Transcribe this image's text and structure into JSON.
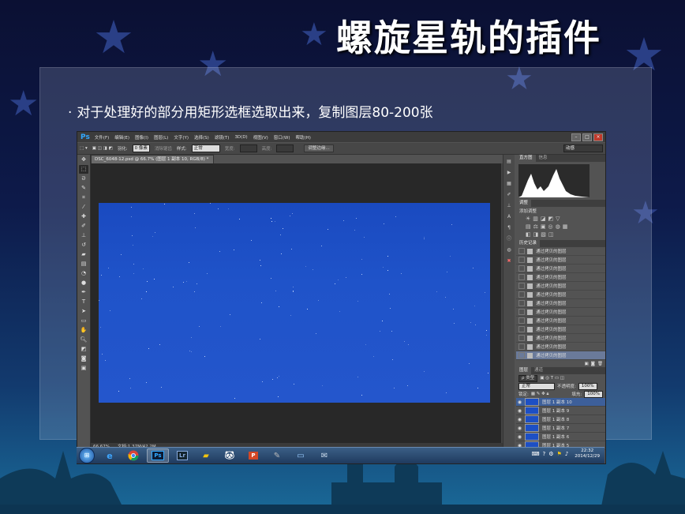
{
  "slide": {
    "title": "螺旋星轨的插件",
    "bullet_marker": "·",
    "bullet": "对于处理好的部分用矩形选框选取出来，复制图层80-200张"
  },
  "ps": {
    "logo": "Ps",
    "menus": [
      "文件(F)",
      "编辑(E)",
      "图像(I)",
      "图层(L)",
      "文字(Y)",
      "选择(S)",
      "滤镜(T)",
      "3D(D)",
      "视图(V)",
      "窗口(W)",
      "帮助(H)"
    ],
    "options": {
      "feather_label": "羽化:",
      "feather_value": "0 像素",
      "antialias": "消除锯齿",
      "style_label": "样式:",
      "style_value": "正常",
      "width_label": "宽度:",
      "height_label": "高度:",
      "refine_edge": "调整边缘...",
      "workspace": "动感"
    },
    "doc_tab": "DSC_6048-12.psd @ 66.7% (图层 1 副本 10, RGB/8) *",
    "status": {
      "zoom": "66.67%",
      "doc": "文档:1.37M/42.2M"
    },
    "panels": {
      "histogram_tabs": [
        "直方图",
        "信息"
      ],
      "adjust_tab": "调整",
      "adjust_title": "添加调整",
      "adjust_row1": [
        "☀",
        "▥",
        "◪",
        "◩",
        "▽"
      ],
      "adjust_row2": [
        "▤",
        "⚖",
        "▣",
        "◎",
        "◍",
        "▦"
      ],
      "adjust_row3": [
        "◧",
        "◨",
        "▧",
        "◫"
      ],
      "history_tab": "历史记录",
      "history_items": [
        "通过拷贝的图层",
        "通过拷贝的图层",
        "通过拷贝的图层",
        "通过拷贝的图层",
        "通过拷贝的图层",
        "通过拷贝的图层",
        "通过拷贝的图层",
        "通过拷贝的图层",
        "通过拷贝的图层",
        "通过拷贝的图层",
        "通过拷贝的图层",
        "通过拷贝的图层",
        "通过拷贝的图层"
      ],
      "layers_tabs": [
        "图层",
        "通道"
      ],
      "kind_label": "ρ 类型",
      "blend_mode": "正常",
      "opacity_label": "不透明度:",
      "opacity": "100%",
      "lock_label": "锁定:",
      "fill_label": "填充:",
      "fill": "100%",
      "layers": [
        "图层 1 副本 10",
        "图层 1 副本 9",
        "图层 1 副本 8",
        "图层 1 副本 7",
        "图层 1 副本 6",
        "图层 1 副本 5"
      ]
    }
  },
  "taskbar": {
    "apps": [
      "IE",
      "Chrome",
      "Ps",
      "Lr",
      "Explorer",
      "Game",
      "PowerPoint",
      "Tool",
      "Window",
      "Docs"
    ],
    "time": "22:32",
    "date": "2014/12/29"
  },
  "colors": {
    "photo_sky": "#1f53c9",
    "ps_bg": "#535353",
    "ps_blue": "#31a8ff",
    "taskbar": "#2d4c72"
  }
}
